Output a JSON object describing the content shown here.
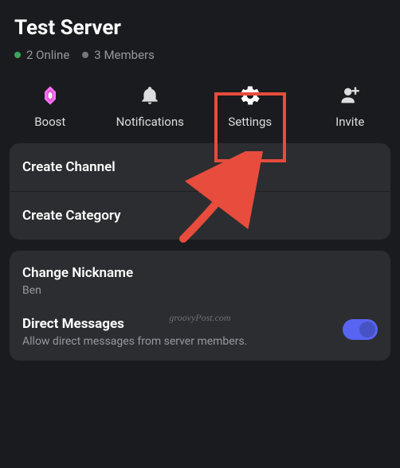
{
  "server": {
    "title": "Test Server",
    "online_count": "2 Online",
    "members_count": "3 Members"
  },
  "actions": {
    "boost": "Boost",
    "notifications": "Notifications",
    "settings": "Settings",
    "invite": "Invite"
  },
  "options": {
    "create_channel": "Create Channel",
    "create_category": "Create Category",
    "change_nickname": "Change Nickname",
    "nickname_value": "Ben",
    "direct_messages_title": "Direct Messages",
    "direct_messages_desc": "Allow direct messages from server members."
  },
  "watermark": "groovyPost.com",
  "colors": {
    "highlight": "#e74c3c",
    "online": "#3ba55d",
    "toggle": "#5865f2"
  }
}
